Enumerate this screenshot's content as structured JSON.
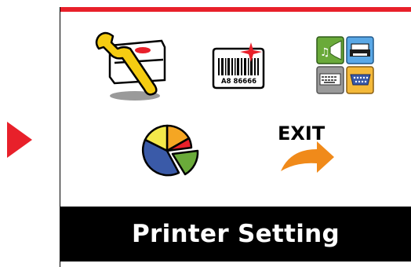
{
  "screen": {
    "title": "Printer Setting",
    "accent_color": "#e8202a"
  },
  "menu_items": [
    {
      "name": "printer-setup",
      "icon": "wrench-printer-icon",
      "selected": true
    },
    {
      "name": "barcode-label",
      "icon": "barcode-label-icon",
      "barcode_text": "A8 86666"
    },
    {
      "name": "interface",
      "icon": "interface-tiles-icon"
    },
    {
      "name": "statistics",
      "icon": "pie-chart-icon"
    },
    {
      "name": "exit",
      "icon": "exit-arrow-icon",
      "label": "EXIT"
    }
  ],
  "navigation": {
    "arrow_icon": "right-triangle-arrow-icon",
    "color": "#e8202a"
  }
}
